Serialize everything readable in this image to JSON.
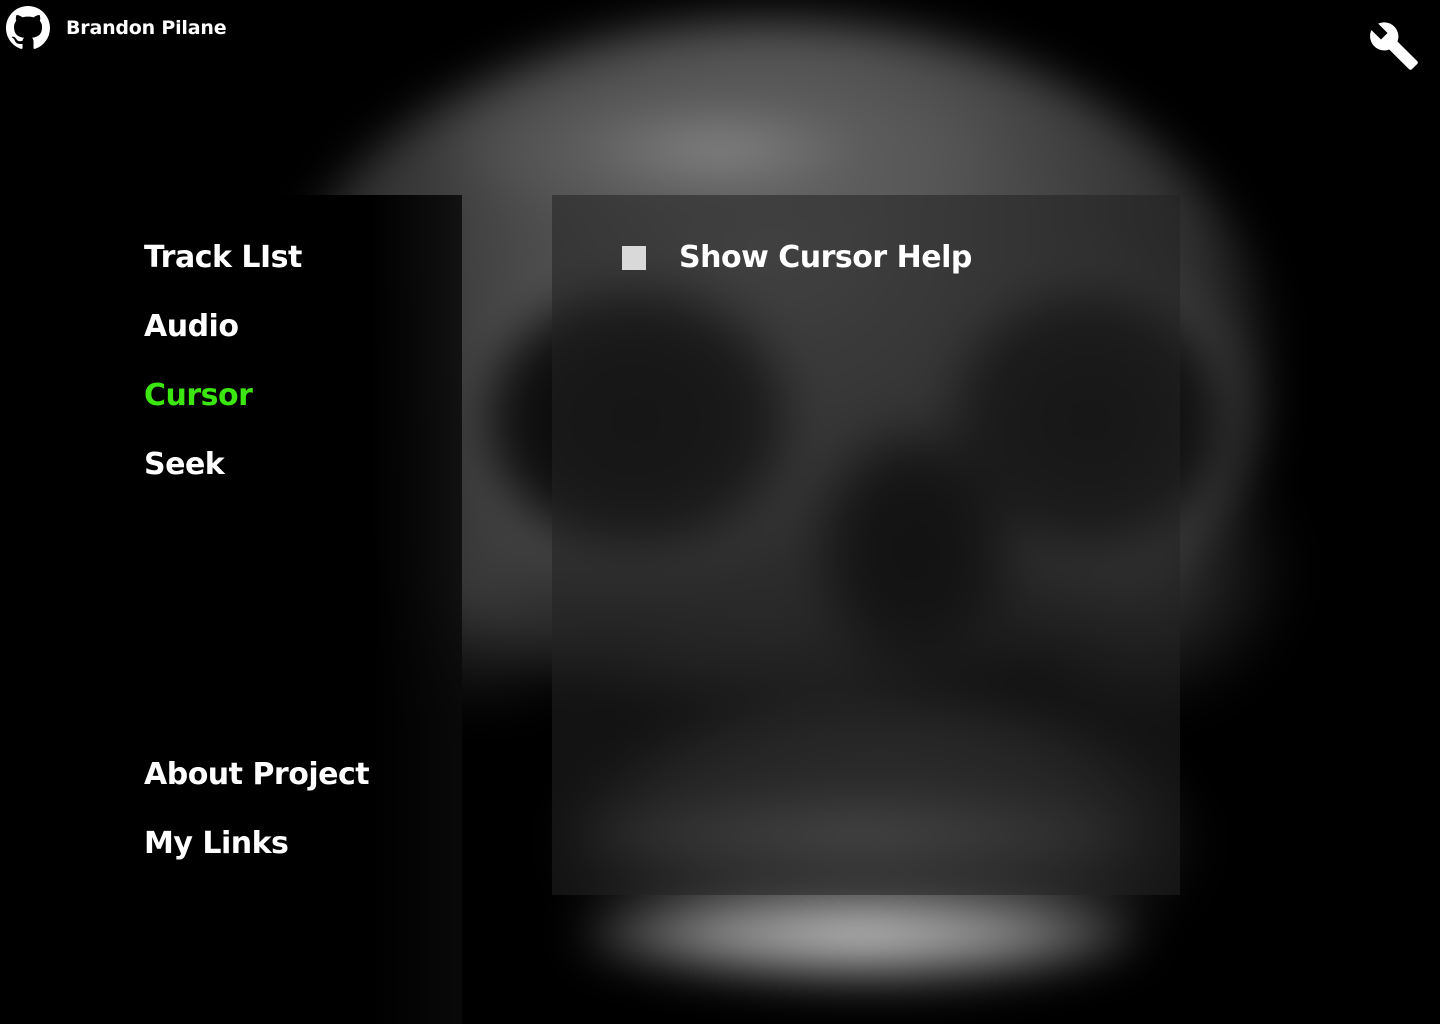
{
  "header": {
    "author_name": "Brandon Pilane",
    "github_icon": "github-icon",
    "settings_icon": "wrench-icon"
  },
  "nav": {
    "items": [
      {
        "label": "Track LIst",
        "active": false
      },
      {
        "label": "Audio",
        "active": false
      },
      {
        "label": "Cursor",
        "active": true
      },
      {
        "label": "Seek",
        "active": false
      }
    ],
    "bottom_items": [
      {
        "label": "About Project"
      },
      {
        "label": "My Links"
      }
    ]
  },
  "cursor_settings": {
    "show_cursor_help": {
      "label": "Show Cursor Help",
      "checked": false
    }
  },
  "colors": {
    "background": "#000000",
    "text": "#ffffff",
    "active": "#3be611",
    "checkbox": "#d9d9d9"
  }
}
